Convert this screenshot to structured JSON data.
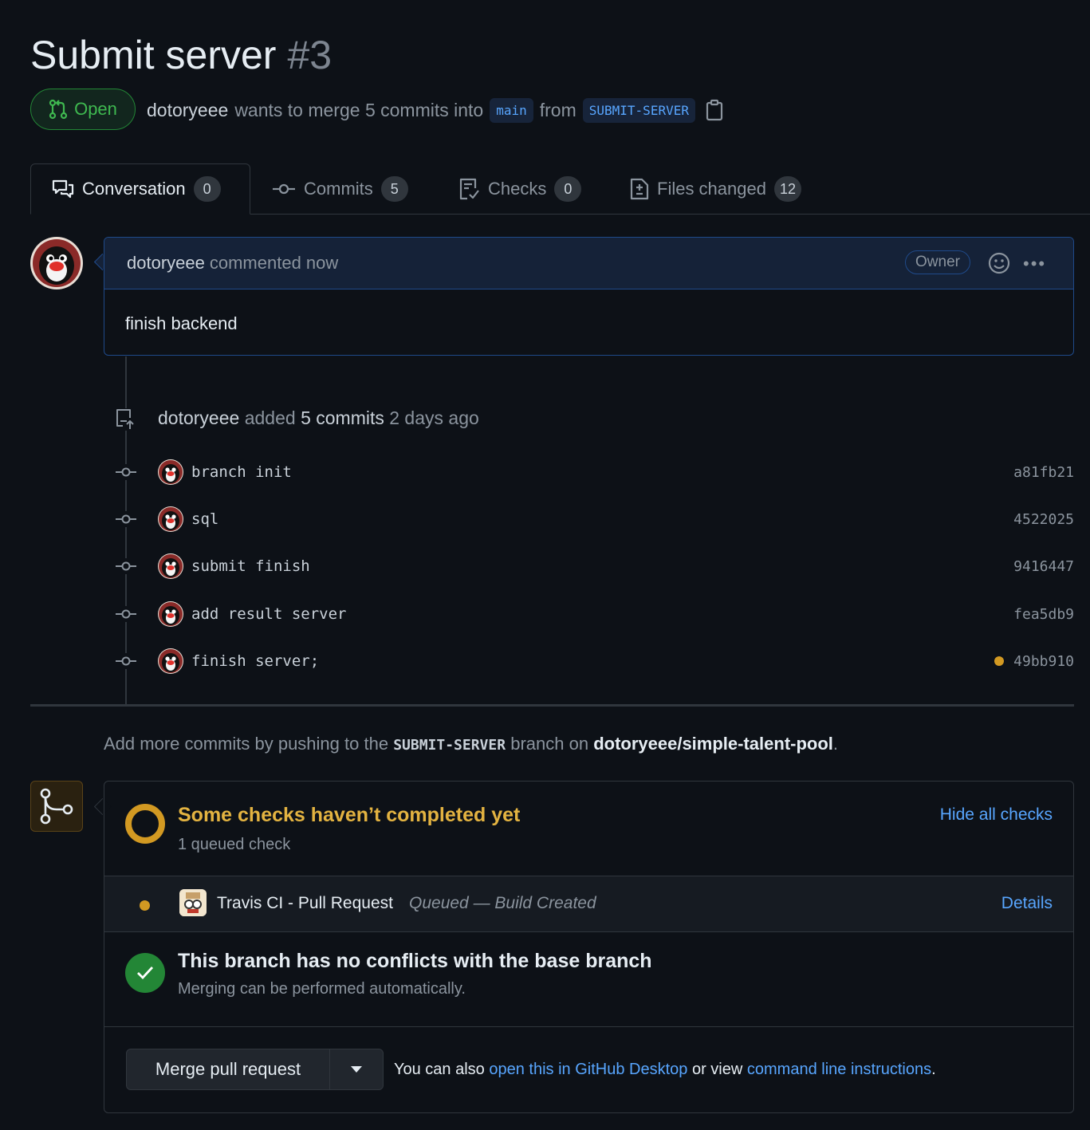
{
  "pr": {
    "title": "Submit server",
    "number": "#3",
    "state": "Open",
    "author": "dotoryeee",
    "merge_text": "wants to merge 5 commits into",
    "base_branch": "main",
    "from_text": "from",
    "head_branch": "SUBMIT-SERVER"
  },
  "tabs": [
    {
      "label": "Conversation",
      "count": "0",
      "icon": "comment-discussion-icon"
    },
    {
      "label": "Commits",
      "count": "5",
      "icon": "git-commit-icon"
    },
    {
      "label": "Checks",
      "count": "0",
      "icon": "checklist-icon"
    },
    {
      "label": "Files changed",
      "count": "12",
      "icon": "file-diff-icon"
    }
  ],
  "comment": {
    "author": "dotoryeee",
    "action": "commented now",
    "badge": "Owner",
    "body": "finish backend"
  },
  "push_event": {
    "author": "dotoryeee",
    "added": "added",
    "count": "5 commits",
    "time": "2 days ago"
  },
  "commits": [
    {
      "message": "branch init",
      "sha": "a81fb21",
      "pending": false
    },
    {
      "message": "sql",
      "sha": "4522025",
      "pending": false
    },
    {
      "message": "submit finish",
      "sha": "9416447",
      "pending": false
    },
    {
      "message": "add result server",
      "sha": "fea5db9",
      "pending": false
    },
    {
      "message": "finish server;",
      "sha": "49bb910",
      "pending": true
    }
  ],
  "push_hint": {
    "prefix": "Add more commits by pushing to the",
    "branch": "SUBMIT-SERVER",
    "middle": "branch on",
    "repo": "dotoryeee/simple-talent-pool",
    "suffix": "."
  },
  "checks": {
    "title": "Some checks haven’t completed yet",
    "subtitle": "1 queued check",
    "hide_link": "Hide all checks",
    "item_name": "Travis CI - Pull Request",
    "item_status": "Queued — Build Created",
    "details_link": "Details"
  },
  "conflicts": {
    "title": "This branch has no conflicts with the base branch",
    "subtitle": "Merging can be performed automatically."
  },
  "merge": {
    "button_label": "Merge pull request",
    "hint_prefix": "You can also",
    "desktop_link": "open this in GitHub Desktop",
    "hint_middle": "or view",
    "cli_link": "command line instructions",
    "hint_suffix": "."
  },
  "colors": {
    "background": "#0d1117",
    "open_green": "#3fb950",
    "link_blue": "#58a6ff",
    "pending_yellow": "#d29922"
  }
}
